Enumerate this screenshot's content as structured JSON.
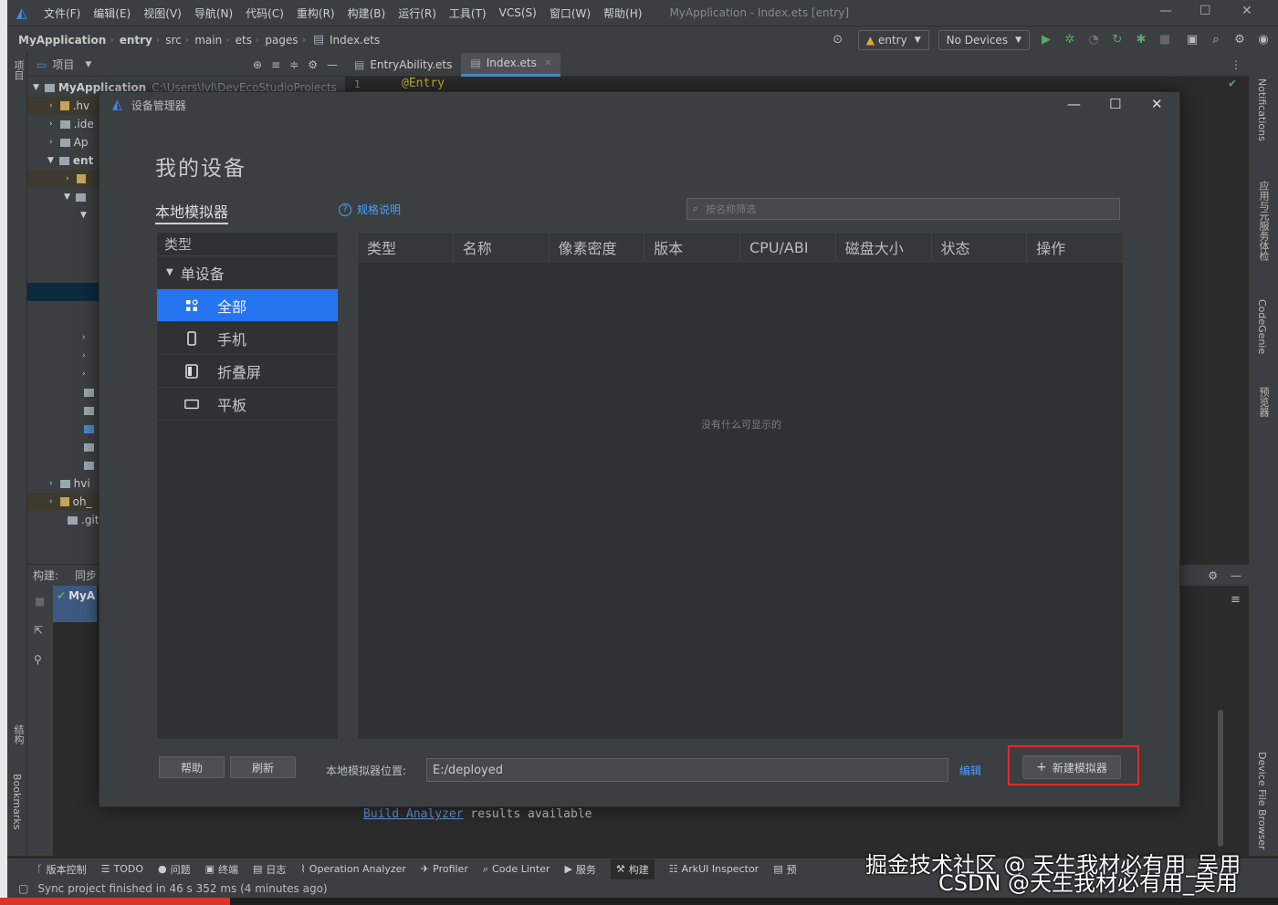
{
  "window": {
    "menu": [
      "文件(F)",
      "编辑(E)",
      "视图(V)",
      "导航(N)",
      "代码(C)",
      "重构(R)",
      "构建(B)",
      "运行(R)",
      "工具(T)",
      "VCS(S)",
      "窗口(W)",
      "帮助(H)"
    ],
    "title": "MyApplication - Index.ets [entry]"
  },
  "navbar": {
    "breadcrumb": [
      "MyApplication",
      "entry",
      "src",
      "main",
      "ets",
      "pages",
      "Index.ets"
    ],
    "run_config": "entry",
    "device_select": "No Devices"
  },
  "project_panel": {
    "title": "项目",
    "root_name": "MyApplication",
    "root_path": "C:\\Users\\lvl\\DevEcoStudioProjects",
    "items": [
      ".hv",
      ".ide",
      "Ap",
      "ent",
      "hvi",
      "oh_",
      ".git"
    ]
  },
  "editor": {
    "tabs": [
      "EntryAbility.ets",
      "Index.ets"
    ],
    "line_number": "1",
    "code_line": "@Entry"
  },
  "dialog": {
    "title": "设备管理器",
    "heading": "我的设备",
    "tab": "本地模拟器",
    "spec_link": "规格说明",
    "search_placeholder": "按名称筛选",
    "type_header": "类型",
    "group": "单设备",
    "categories": [
      "全部",
      "手机",
      "折叠屏",
      "平板"
    ],
    "columns": [
      "类型",
      "名称",
      "像素密度",
      "版本",
      "CPU/ABI",
      "磁盘大小",
      "状态",
      "操作"
    ],
    "empty_text": "没有什么可显示的",
    "help_button": "帮助",
    "refresh_button": "刷新",
    "location_label": "本地模拟器位置:",
    "location_value": "E:/deployed",
    "edit_link": "编辑",
    "new_emulator_button": "新建模拟器",
    "highlight_color": "#e0282c",
    "accent_color": "#2675f0"
  },
  "build": {
    "label": "构建:",
    "sync": "同步",
    "tree_item": "MyA",
    "output_link": "Build Analyzer",
    "output_text": " results available"
  },
  "tool_windows": [
    "版本控制",
    "TODO",
    "问题",
    "终端",
    "日志",
    "Operation Analyzer",
    "Profiler",
    "Code Linter",
    "服务",
    "构建",
    "ArkUI Inspector",
    "预"
  ],
  "status": "Sync project finished in 46 s 352 ms (4 minutes ago)",
  "right_stripe": [
    "Notifications",
    "应用与元服务体检",
    "CodeGenie",
    "预览器",
    "Device File Browser"
  ],
  "left_stripe": [
    "项目",
    "结构",
    "Bookmarks"
  ],
  "watermark": {
    "line1": "掘金技术社区 @ 天生我材必有用_吴用",
    "line2": "CSDN @天生我材必有用_吴用"
  }
}
